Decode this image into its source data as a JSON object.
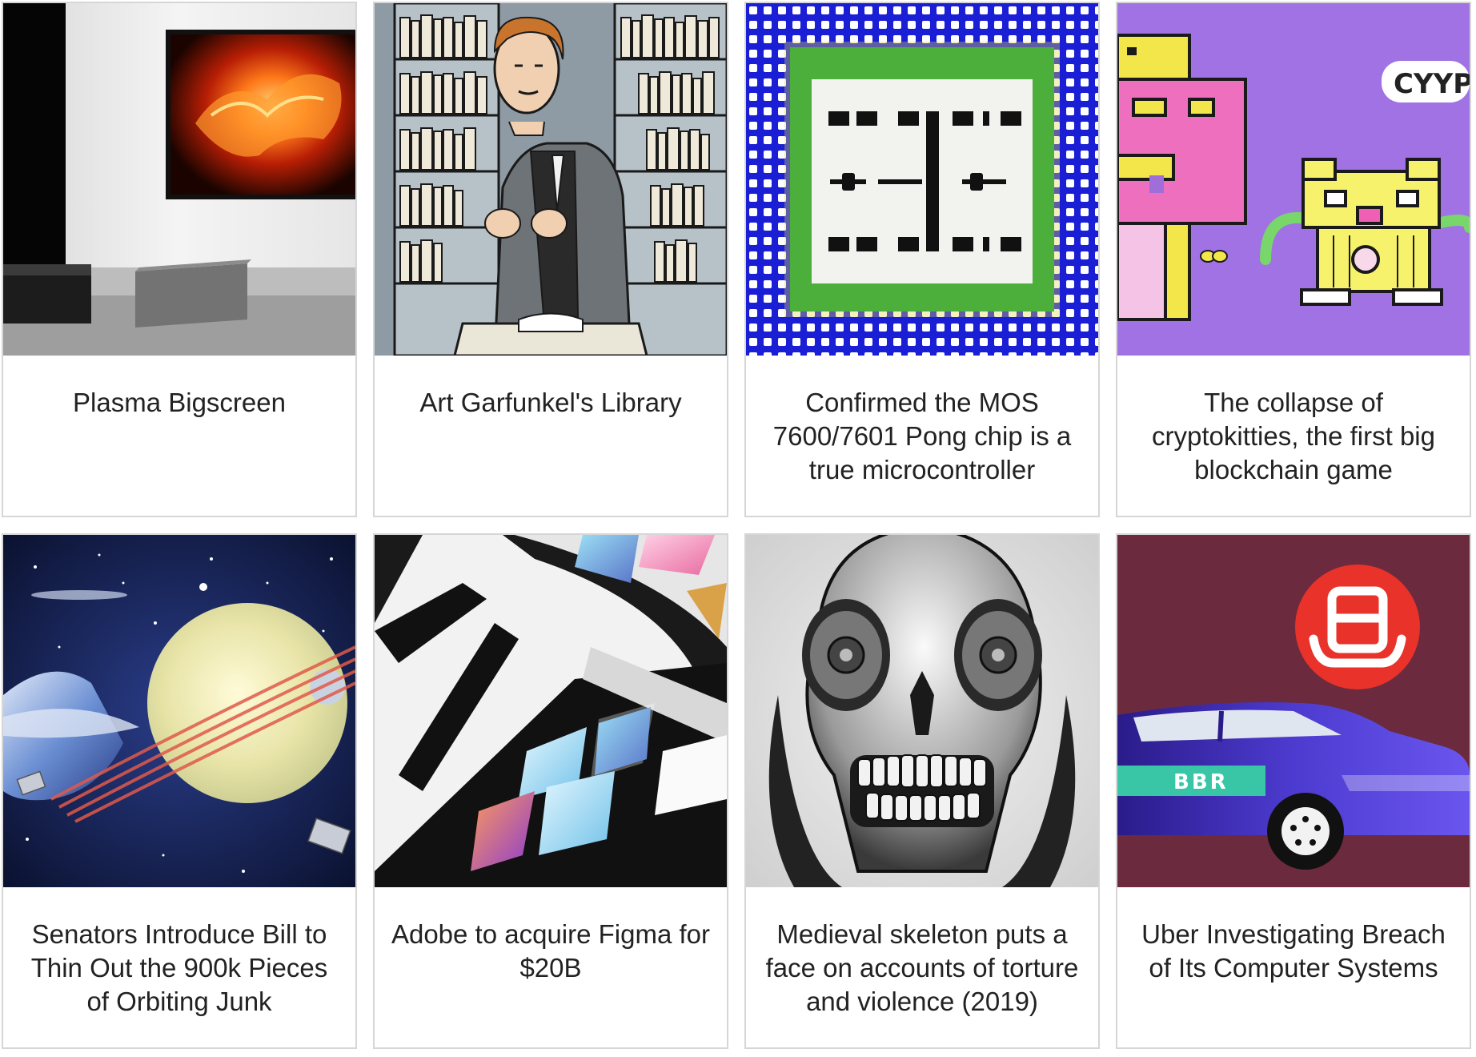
{
  "cards": [
    {
      "title": "Plasma Bigscreen",
      "image": "living-room-tv-image"
    },
    {
      "title": "Art Garfunkel's Library",
      "image": "library-portrait-image"
    },
    {
      "title": "Confirmed the MOS 7600/7601 Pong chip is a true microcontroller",
      "image": "chip-image"
    },
    {
      "title": "The collapse of cryptokitties, the first big blockchain game",
      "image": "pixel-cat-image",
      "sign_text": "CYYP"
    },
    {
      "title": "Senators Introduce Bill to Thin Out the 900k Pieces of Orbiting Junk",
      "image": "space-planets-image"
    },
    {
      "title": "Adobe to acquire Figma for $20B",
      "image": "abstract-figma-image"
    },
    {
      "title": "Medieval skeleton puts a face on accounts of torture and violence (2019)",
      "image": "skull-image"
    },
    {
      "title": "Uber Investigating Breach of Its Computer Systems",
      "image": "car-logo-image",
      "car_text": "BBR"
    }
  ]
}
